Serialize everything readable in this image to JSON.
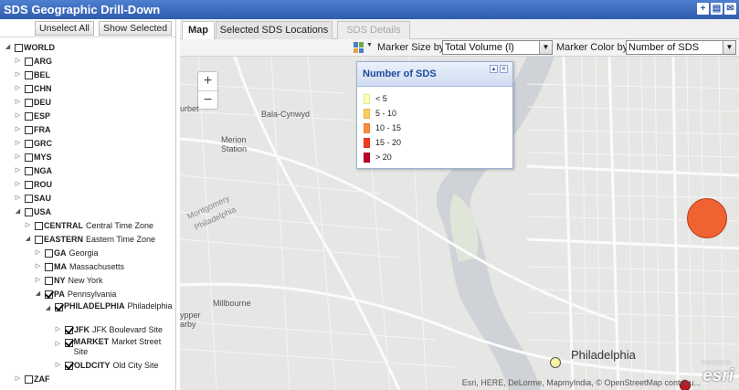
{
  "app": {
    "title": "SDS Geographic Drill-Down"
  },
  "tree_buttons": {
    "unselect_all": "Unselect All",
    "show_selected": "Show Selected"
  },
  "tree": [
    {
      "level": 0,
      "expander": "open",
      "checked": false,
      "code": "WORLD",
      "label": ""
    },
    {
      "level": 1,
      "expander": "closed",
      "checked": false,
      "code": "ARG",
      "label": ""
    },
    {
      "level": 1,
      "expander": "closed",
      "checked": false,
      "code": "BEL",
      "label": ""
    },
    {
      "level": 1,
      "expander": "closed",
      "checked": false,
      "code": "CHN",
      "label": ""
    },
    {
      "level": 1,
      "expander": "closed",
      "checked": false,
      "code": "DEU",
      "label": ""
    },
    {
      "level": 1,
      "expander": "closed",
      "checked": false,
      "code": "ESP",
      "label": ""
    },
    {
      "level": 1,
      "expander": "closed",
      "checked": false,
      "code": "FRA",
      "label": ""
    },
    {
      "level": 1,
      "expander": "closed",
      "checked": false,
      "code": "GRC",
      "label": ""
    },
    {
      "level": 1,
      "expander": "closed",
      "checked": false,
      "code": "MYS",
      "label": ""
    },
    {
      "level": 1,
      "expander": "closed",
      "checked": false,
      "code": "NGA",
      "label": ""
    },
    {
      "level": 1,
      "expander": "closed",
      "checked": false,
      "code": "ROU",
      "label": ""
    },
    {
      "level": 1,
      "expander": "closed",
      "checked": false,
      "code": "SAU",
      "label": ""
    },
    {
      "level": 1,
      "expander": "open",
      "checked": false,
      "code": "USA",
      "label": ""
    },
    {
      "level": 2,
      "expander": "closed",
      "checked": false,
      "code": "CENTRAL",
      "label": "Central Time Zone"
    },
    {
      "level": 2,
      "expander": "open",
      "checked": false,
      "code": "EASTERN",
      "label": "Eastern Time Zone"
    },
    {
      "level": 3,
      "expander": "closed",
      "checked": false,
      "code": "GA",
      "label": "Georgia"
    },
    {
      "level": 3,
      "expander": "closed",
      "checked": false,
      "code": "MA",
      "label": "Massachusetts"
    },
    {
      "level": 3,
      "expander": "closed",
      "checked": false,
      "code": "NY",
      "label": "New York"
    },
    {
      "level": 3,
      "expander": "open",
      "checked": true,
      "code": "PA",
      "label": "Pennsylvania"
    },
    {
      "level": 4,
      "expander": "open",
      "checked": true,
      "code": "PHILADELPHIA",
      "label": "Philadelphia",
      "multiline": true
    },
    {
      "level": 5,
      "expander": "closed",
      "checked": true,
      "code": "JFK",
      "label": "JFK Boulevard Site"
    },
    {
      "level": 5,
      "expander": "closed",
      "checked": true,
      "code": "MARKET",
      "label": "Market Street Site",
      "multiline": true
    },
    {
      "level": 5,
      "expander": "closed",
      "checked": true,
      "code": "OLDCITY",
      "label": "Old City Site"
    },
    {
      "level": 1,
      "expander": "closed",
      "checked": false,
      "code": "ZAF",
      "label": ""
    }
  ],
  "tabs": [
    {
      "label": "Map",
      "state": "active"
    },
    {
      "label": "Selected SDS Locations",
      "state": "normal"
    },
    {
      "label": "SDS Details",
      "state": "disabled"
    }
  ],
  "toolbar": {
    "marker_size_label": "Marker Size by",
    "marker_size_value": "Total Volume (l)",
    "marker_color_label": "Marker Color by",
    "marker_color_value": "Number of SDS"
  },
  "map": {
    "zoom_in": "+",
    "zoom_out": "−",
    "labels": [
      {
        "text": "Bala-Cynwyd"
      },
      {
        "text": "Merion"
      },
      {
        "text": "Station"
      },
      {
        "text": "Montgomery"
      },
      {
        "text": "Philadelphia"
      },
      {
        "text": "urbet"
      },
      {
        "text": "Millbourne"
      },
      {
        "text": "ypper"
      },
      {
        "text": "arby"
      },
      {
        "text": "Philadelphia"
      }
    ],
    "attribution": "Esri, HERE, DeLorme, MapmyIndia, © OpenStreetMap contribu...",
    "esri_logo": "esri",
    "esri_powered": "POWERED BY",
    "markers": [
      {
        "color": "#f16232",
        "stroke": "#b23a16"
      },
      {
        "color": "#f7f2a2",
        "stroke": "#555555"
      },
      {
        "color": "#c3161f",
        "stroke": "#7a0b10"
      }
    ]
  },
  "legend": {
    "title": "Number of SDS",
    "items": [
      {
        "label": "< 5",
        "color": "#ffffb2"
      },
      {
        "label": "5 - 10",
        "color": "#fecc5c"
      },
      {
        "label": "10 - 15",
        "color": "#fd8d3c"
      },
      {
        "label": "15 - 20",
        "color": "#f03b20"
      },
      {
        "label": "> 20",
        "color": "#bd0026"
      }
    ]
  }
}
